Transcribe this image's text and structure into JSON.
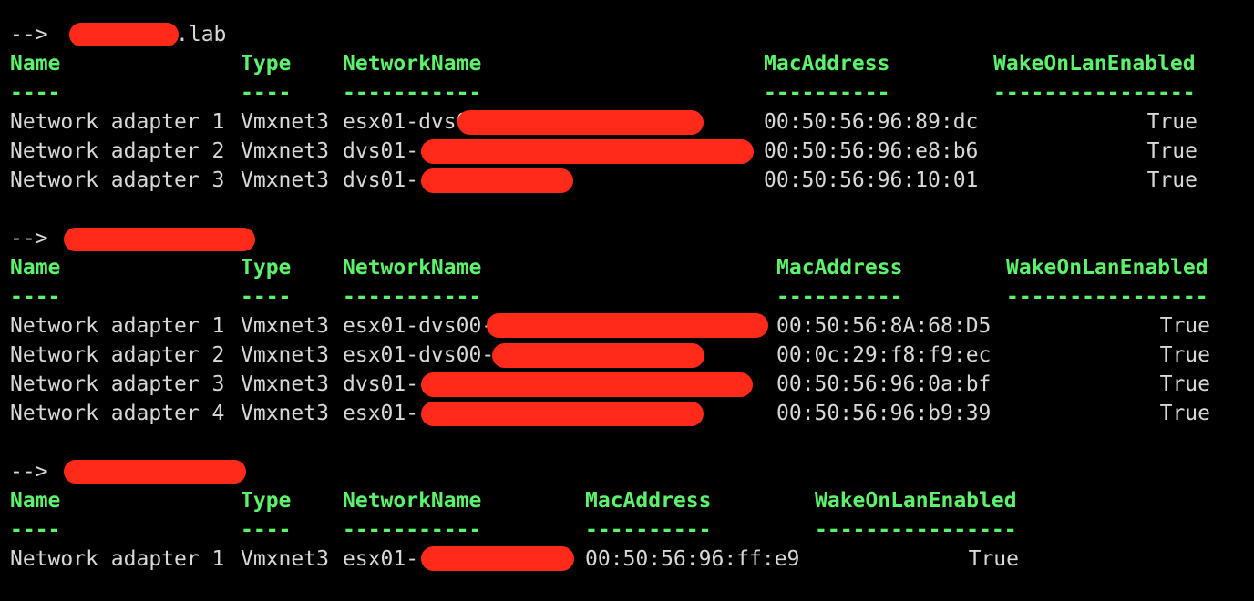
{
  "colors": {
    "background": "#000000",
    "text": "#d8d8d8",
    "header": "#5cf26c",
    "redaction": "#ff2a1a"
  },
  "blocks": [
    {
      "prompt": "-->",
      "host_suffix": ".lab",
      "headers": [
        "Name",
        "Type",
        "NetworkName",
        "MacAddress",
        "WakeOnLanEnabled"
      ],
      "dashes": [
        "----",
        "----",
        "-----------",
        "----------",
        "----------------"
      ],
      "rows": [
        {
          "name": "Network adapter 1",
          "type": "Vmxnet3",
          "network": "esx01-dvs0",
          "mac": "00:50:56:96:89:dc",
          "wol": "True"
        },
        {
          "name": "Network adapter 2",
          "type": "Vmxnet3",
          "network": "dvs01-",
          "mac": "00:50:56:96:e8:b6",
          "wol": "True"
        },
        {
          "name": "Network adapter 3",
          "type": "Vmxnet3",
          "network": "dvs01-",
          "mac": "00:50:56:96:10:01",
          "wol": "True"
        }
      ]
    },
    {
      "prompt": "-->",
      "host_suffix": "",
      "headers": [
        "Name",
        "Type",
        "NetworkName",
        "MacAddress",
        "WakeOnLanEnabled"
      ],
      "dashes": [
        "----",
        "----",
        "-----------",
        "----------",
        "----------------"
      ],
      "rows": [
        {
          "name": "Network adapter 1",
          "type": "Vmxnet3",
          "network": "esx01-dvs00-",
          "mac": "00:50:56:8A:68:D5",
          "wol": "True"
        },
        {
          "name": "Network adapter 2",
          "type": "Vmxnet3",
          "network": "esx01-dvs00-",
          "mac": "00:0c:29:f8:f9:ec",
          "wol": "True"
        },
        {
          "name": "Network adapter 3",
          "type": "Vmxnet3",
          "network": "dvs01-",
          "mac": "00:50:56:96:0a:bf",
          "wol": "True"
        },
        {
          "name": "Network adapter 4",
          "type": "Vmxnet3",
          "network": "esx01-",
          "mac": "00:50:56:96:b9:39",
          "wol": "True"
        }
      ]
    },
    {
      "prompt": "-->",
      "host_suffix": "",
      "headers": [
        "Name",
        "Type",
        "NetworkName",
        "MacAddress",
        "WakeOnLanEnabled"
      ],
      "dashes": [
        "----",
        "----",
        "-----------",
        "----------",
        "----------------"
      ],
      "rows": [
        {
          "name": "Network adapter 1",
          "type": "Vmxnet3",
          "network": "esx01-",
          "mac": "00:50:56:96:ff:e9",
          "wol": "True"
        }
      ]
    }
  ]
}
